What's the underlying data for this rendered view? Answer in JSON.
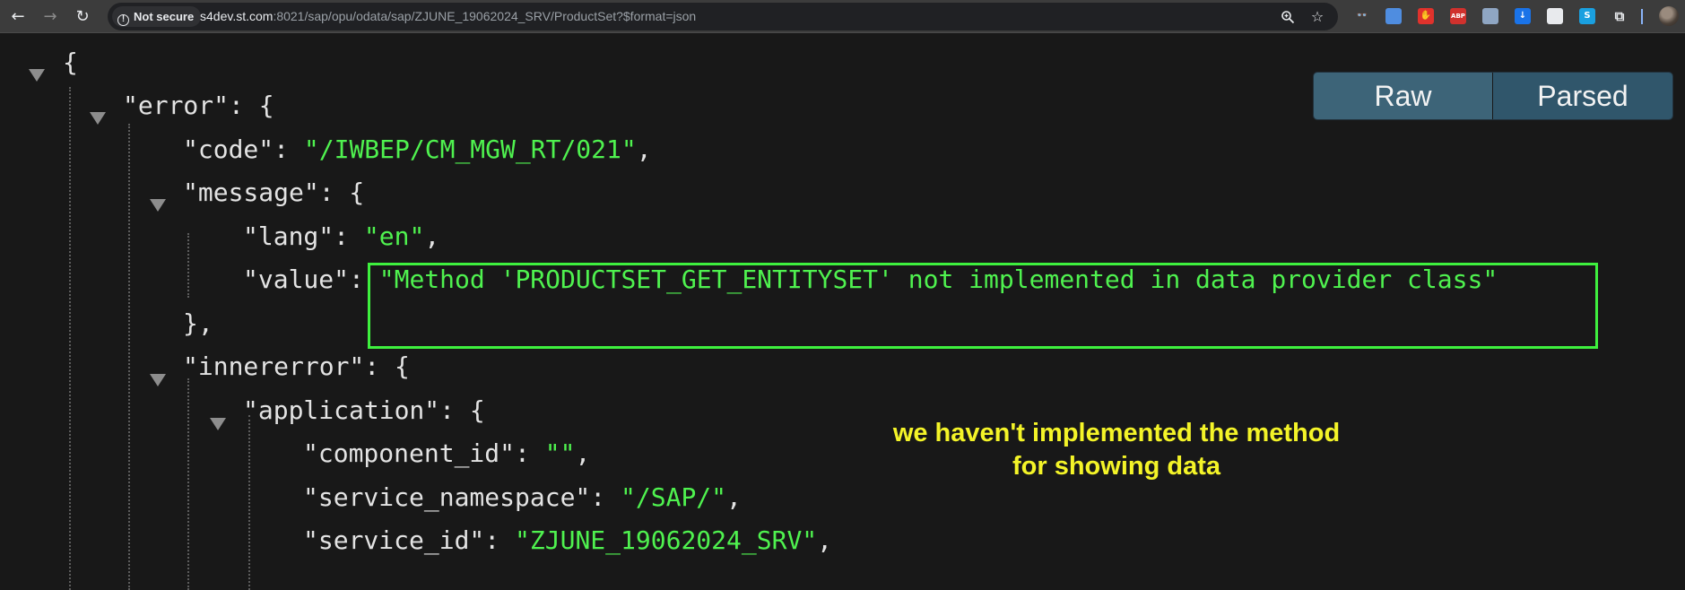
{
  "browser": {
    "security_badge": "Not secure",
    "url_host": "s4dev.st.com",
    "url_rest": ":8021/sap/opu/odata/sap/ZJUNE_19062024_SRV/ProductSet?$format=json",
    "icons": [
      "back-icon",
      "forward-icon",
      "reload-icon",
      "zoom-icon",
      "bookmark-star-icon",
      "extensions-puzzle-icon",
      "profile-avatar"
    ],
    "extensions": [
      {
        "name": "extension-glasses-icon",
        "glyph": "👓",
        "bg": "#3c3c3c"
      },
      {
        "name": "extension-file-icon",
        "glyph": "",
        "bg": "#4f8de0"
      },
      {
        "name": "extension-stop-icon",
        "glyph": "✋",
        "bg": "#e0322c"
      },
      {
        "name": "extension-abp-icon",
        "glyph": "ABP",
        "bg": "#d0312d"
      },
      {
        "name": "extension-card-icon",
        "glyph": "",
        "bg": "#8fa6c3"
      },
      {
        "name": "extension-download-icon",
        "glyph": "↓",
        "bg": "#1a73e8"
      },
      {
        "name": "extension-cloud-icon",
        "glyph": "",
        "bg": "#e8eaed"
      },
      {
        "name": "extension-s-icon",
        "glyph": "S",
        "bg": "#1aa0e0"
      }
    ]
  },
  "viewer": {
    "toggle_raw": "Raw",
    "toggle_parsed": "Parsed",
    "lines": {
      "l0": "{",
      "l1_key": "\"error\"",
      "l1_rest": ": {",
      "l2_key": "\"code\"",
      "l2_sep": ": ",
      "l2_val": "\"/IWBEP/CM_MGW_RT/021\"",
      "l2_end": ",",
      "l3_key": "\"message\"",
      "l3_rest": ": {",
      "l4_key": "\"lang\"",
      "l4_sep": ": ",
      "l4_val": "\"en\"",
      "l4_end": ",",
      "l5_key": "\"value\"",
      "l5_sep": ": ",
      "l5_val": "\"Method 'PRODUCTSET_GET_ENTITYSET' not implemented in data provider class\"",
      "l6": "},",
      "l7_key": "\"innererror\"",
      "l7_rest": ": {",
      "l8_key": "\"application\"",
      "l8_rest": ": {",
      "l9_key": "\"component_id\"",
      "l9_sep": ": ",
      "l9_val": "\"\"",
      "l9_end": ",",
      "l10_key": "\"service_namespace\"",
      "l10_sep": ": ",
      "l10_val": "\"/SAP/\"",
      "l10_end": ",",
      "l11_key": "\"service_id\"",
      "l11_sep": ": ",
      "l11_val": "\"ZJUNE_19062024_SRV\"",
      "l11_end": ","
    }
  },
  "annotation": {
    "line1": "we haven't implemented the method",
    "line2": "for showing data",
    "box_color": "#3ef03e",
    "text_color": "#f4f428"
  },
  "colors": {
    "string_value": "#4ff24f",
    "key": "#e3e3e3",
    "background": "#181818",
    "toggle_bg": "#3d6478"
  }
}
